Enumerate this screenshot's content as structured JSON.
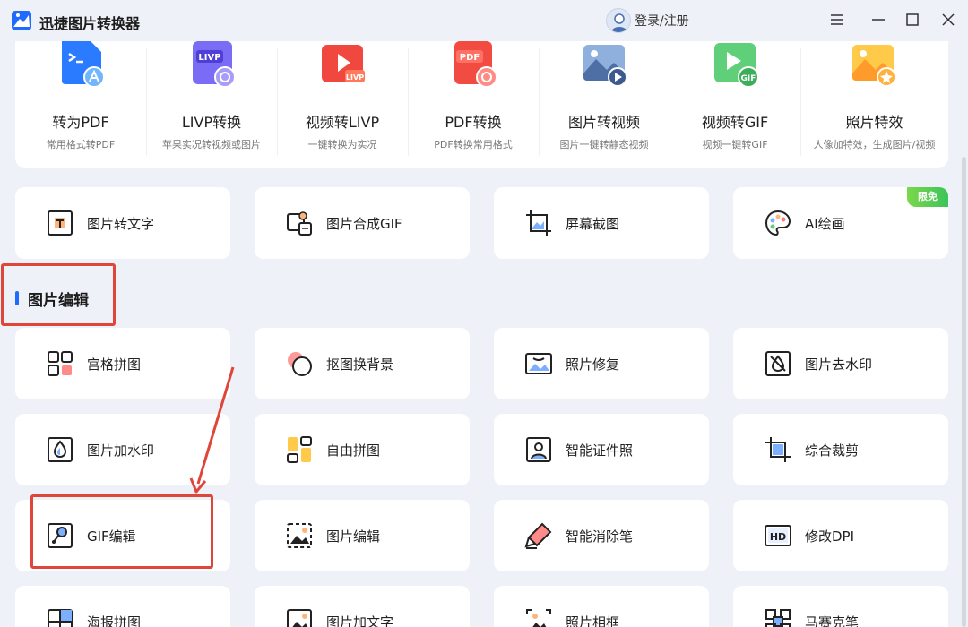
{
  "app": {
    "title": "迅捷图片转换器",
    "login_label": "登录/注册"
  },
  "top_tools": [
    {
      "label": "转为PDF",
      "desc": "常用格式转PDF",
      "icon": "file-to-pdf-icon"
    },
    {
      "label": "LIVP转换",
      "desc": "苹果实况转视频或图片",
      "icon": "livp-convert-icon"
    },
    {
      "label": "视频转LIVP",
      "desc": "一键转换为实况",
      "icon": "video-to-livp-icon"
    },
    {
      "label": "PDF转换",
      "desc": "PDF转换常用格式",
      "icon": "pdf-convert-icon"
    },
    {
      "label": "图片转视频",
      "desc": "图片一键转静态视频",
      "icon": "image-to-video-icon"
    },
    {
      "label": "视频转GIF",
      "desc": "视频一键转GIF",
      "icon": "video-to-gif-icon"
    },
    {
      "label": "照片特效",
      "desc": "人像加特效，生成图片/视频",
      "icon": "photo-effect-icon"
    }
  ],
  "quick_tools": [
    {
      "label": "图片转文字",
      "icon": "image-to-text-icon"
    },
    {
      "label": "图片合成GIF",
      "icon": "images-to-gif-icon"
    },
    {
      "label": "屏幕截图",
      "icon": "screenshot-icon"
    },
    {
      "label": "AI绘画",
      "icon": "palette-icon",
      "badge": "限免"
    }
  ],
  "section": {
    "title": "图片编辑"
  },
  "edit_tools": [
    {
      "label": "宫格拼图",
      "icon": "grid-collage-icon"
    },
    {
      "label": "抠图换背景",
      "icon": "cutout-background-icon"
    },
    {
      "label": "照片修复",
      "icon": "photo-repair-icon"
    },
    {
      "label": "图片去水印",
      "icon": "remove-watermark-icon"
    },
    {
      "label": "图片加水印",
      "icon": "add-watermark-icon"
    },
    {
      "label": "自由拼图",
      "icon": "free-collage-icon"
    },
    {
      "label": "智能证件照",
      "icon": "id-photo-icon"
    },
    {
      "label": "综合裁剪",
      "icon": "crop-icon"
    },
    {
      "label": "GIF编辑",
      "icon": "gif-edit-icon"
    },
    {
      "label": "图片编辑",
      "icon": "image-edit-icon"
    },
    {
      "label": "智能消除笔",
      "icon": "eraser-pen-icon"
    },
    {
      "label": "修改DPI",
      "icon": "hd-dpi-icon"
    },
    {
      "label": "海报拼图",
      "icon": "poster-collage-icon"
    },
    {
      "label": "图片加文字",
      "icon": "image-add-text-icon"
    },
    {
      "label": "照片相框",
      "icon": "photo-frame-icon"
    },
    {
      "label": "马赛克笔",
      "icon": "mosaic-icon"
    }
  ],
  "colors": {
    "accent": "#1f6bff",
    "highlight": "#e0453a",
    "badge": "#3cc35a"
  }
}
